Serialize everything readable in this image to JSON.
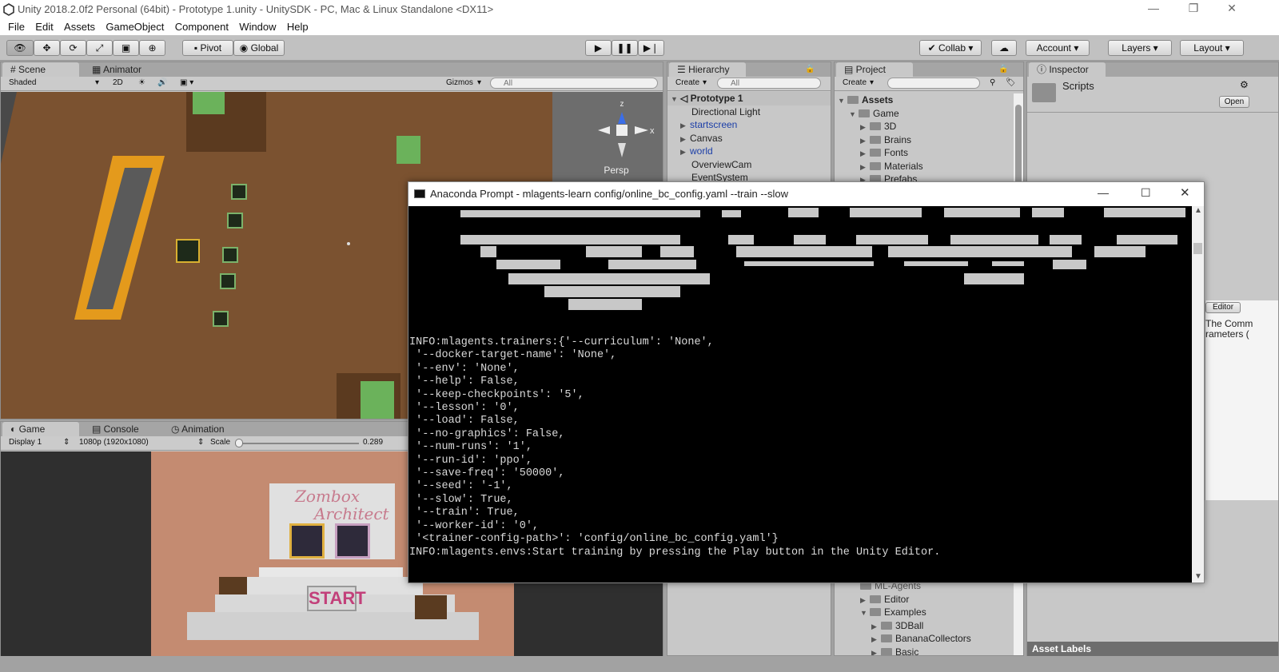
{
  "window": {
    "title": "Unity 2018.2.0f2 Personal (64bit) - Prototype 1.unity - UnitySDK - PC, Mac & Linux Standalone <DX11>",
    "minimize": "—",
    "maximize": "❐",
    "close": "✕"
  },
  "menu": [
    "File",
    "Edit",
    "Assets",
    "GameObject",
    "Component",
    "Window",
    "Help"
  ],
  "toolbar": {
    "pivot": "Pivot",
    "global": "Global",
    "collab": "Collab",
    "account": "Account",
    "layers": "Layers",
    "layout": "Layout"
  },
  "scene": {
    "tabs": [
      "Scene",
      "Animator"
    ],
    "shading": "Shaded",
    "mode2d": "2D",
    "gizmos": "Gizmos",
    "search_placeholder": "All",
    "persp": "Persp",
    "axis_x": "x",
    "axis_z": "z"
  },
  "game": {
    "tabs": [
      "Game",
      "Console",
      "Animation"
    ],
    "display": "Display 1",
    "resolution": "1080p (1920x1080)",
    "scale_label": "Scale",
    "scale_value": "0.289",
    "logo_line1": "Zombox",
    "logo_line2": "Architect",
    "start": "START"
  },
  "hierarchy": {
    "tab": "Hierarchy",
    "create": "Create",
    "search_placeholder": "All",
    "scene": "Prototype 1",
    "items": [
      "Directional Light",
      "startscreen",
      "Canvas",
      "world",
      "OverviewCam",
      "EventSystem"
    ]
  },
  "project": {
    "tab": "Project",
    "create": "Create",
    "root": "Assets",
    "game": "Game",
    "game_children": [
      "3D",
      "Brains",
      "Fonts",
      "Materials",
      "Prefabs"
    ],
    "lower_partial": "ML-Agents",
    "lower_items": [
      "Editor",
      "Examples",
      "3DBall",
      "BananaCollectors",
      "Basic"
    ]
  },
  "inspector": {
    "tab": "Inspector",
    "name": "Scripts",
    "open": "Open",
    "editor_dropdown": "Editor",
    "snippet1": "The Comm",
    "snippet2": "rameters (",
    "asset_labels": "Asset Labels"
  },
  "console": {
    "title": "Anaconda Prompt - mlagents-learn  config/online_bc_config.yaml --train --slow",
    "lines": [
      "INFO:mlagents.trainers:{'--curriculum': 'None',",
      " '--docker-target-name': 'None',",
      " '--env': 'None',",
      " '--help': False,",
      " '--keep-checkpoints': '5',",
      " '--lesson': '0',",
      " '--load': False,",
      " '--no-graphics': False,",
      " '--num-runs': '1',",
      " '--run-id': 'ppo',",
      " '--save-freq': '50000',",
      " '--seed': '-1',",
      " '--slow': True,",
      " '--train': True,",
      " '--worker-id': '0',",
      " '<trainer-config-path>': 'config/online_bc_config.yaml'}",
      "INFO:mlagents.envs:Start training by pressing the Play button in the Unity Editor."
    ]
  },
  "colors": {
    "ground": "#7b5230",
    "wall": "#e49a1c",
    "crate": "#6bb25b",
    "console_bg": "#000000",
    "game_bg": "#c48b71",
    "editor_gray": "#c8c8c8"
  }
}
